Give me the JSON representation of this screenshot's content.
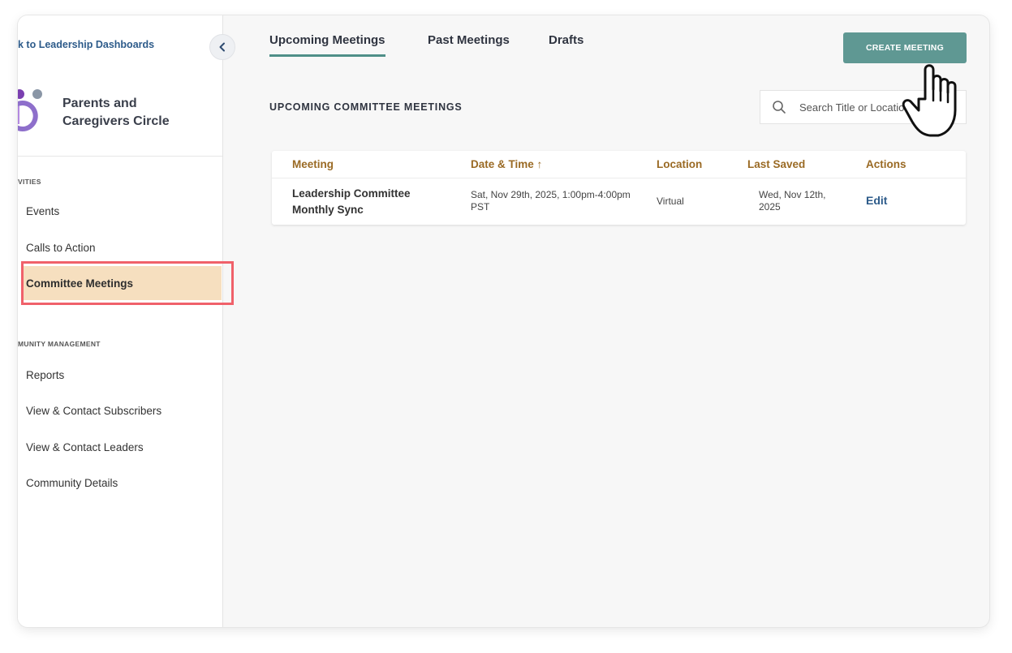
{
  "sidebar": {
    "back_link": "k to Leadership Dashboards",
    "brand_name_line1": "Parents and",
    "brand_name_line2": "Caregivers Circle",
    "section_activities": "VITIES",
    "activities": [
      "Events",
      "Calls to Action",
      "Committee Meetings"
    ],
    "active_item": "Committee Meetings",
    "section_community": "MUNITY MANAGEMENT",
    "community": [
      "Reports",
      "View & Contact Subscribers",
      "View & Contact Leaders",
      "Community Details"
    ]
  },
  "tabs": [
    "Upcoming Meetings",
    "Past Meetings",
    "Drafts"
  ],
  "active_tab": "Upcoming Meetings",
  "create_button": "CREATE MEETING",
  "page_heading": "UPCOMING COMMITTEE MEETINGS",
  "search": {
    "placeholder": "Search Title or Location"
  },
  "table": {
    "columns": [
      "Meeting",
      "Date & Time ↑",
      "Location",
      "Last Saved",
      "Actions"
    ],
    "rows": [
      {
        "meeting_line1": "Leadership Committee",
        "meeting_line2": "Monthly Sync",
        "datetime_line1": "Sat, Nov 29th, 2025, 1:00pm-4:00pm",
        "datetime_line2": "PST",
        "location": "Virtual",
        "last_saved_line1": "Wed, Nov 12th,",
        "last_saved_line2": "2025",
        "action": "Edit"
      }
    ]
  },
  "colors": {
    "accent_teal": "#5f9893",
    "active_nav_bg": "#f6dfbf",
    "highlight_border": "#f0616a",
    "header_text": "#9a6a24",
    "link_blue": "#2d5b8a"
  },
  "icons": [
    "chevron-left-icon",
    "brand-logo",
    "search-icon",
    "hand-pointer-icon"
  ]
}
